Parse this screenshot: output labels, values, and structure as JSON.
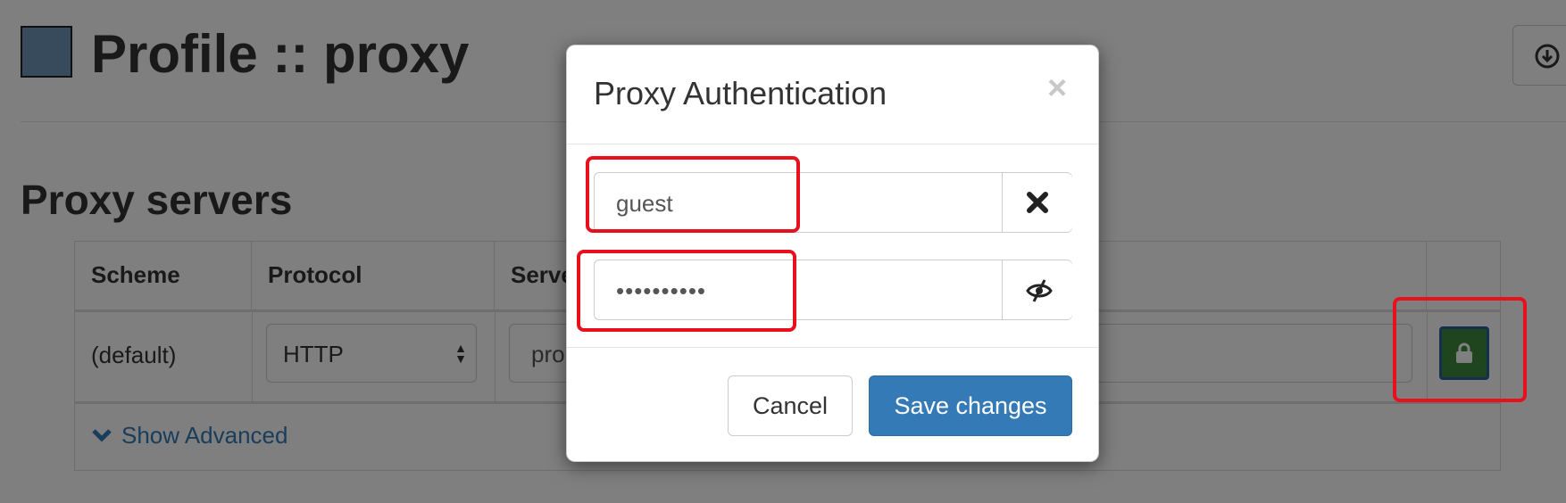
{
  "page": {
    "title": "Profile :: proxy",
    "profile_color": "#6e97b8",
    "download_icon": "download-circle-icon"
  },
  "proxy_servers": {
    "section_title": "Proxy servers",
    "columns": [
      "Scheme",
      "Protocol",
      "Serve"
    ],
    "row": {
      "scheme": "(default)",
      "protocol": "HTTP",
      "server": "pro",
      "auth_icon": "lock-icon",
      "auth_button_color": "#3c8a3c"
    },
    "show_advanced": "Show Advanced"
  },
  "modal": {
    "title": "Proxy Authentication",
    "close_label": "×",
    "username": {
      "value": "guest",
      "addon_icon": "clear-x-icon"
    },
    "password": {
      "value": "••••••••••",
      "addon_icon": "eye-slash-icon"
    },
    "cancel_label": "Cancel",
    "save_label": "Save changes",
    "primary_color": "#337ab7"
  },
  "annotations": {
    "highlight_color": "#e8101c"
  }
}
